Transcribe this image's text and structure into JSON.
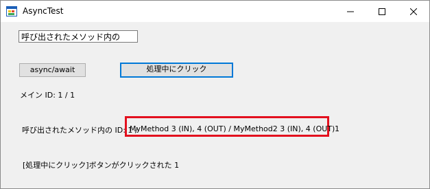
{
  "window": {
    "title": "AsyncTest",
    "controls": {
      "minimize": "minimize-icon",
      "maximize": "maximize-icon",
      "close": "close-icon"
    }
  },
  "form": {
    "textbox_value": "呼び出されたメソッド内の",
    "async_button_label": "async/await",
    "process_button_label": "処理中にクリック",
    "main_id_label": "メイン ID: 1 / 1",
    "called_method_prefix": "呼び出されたメソッド内の ID: 1 /",
    "called_method_highlight": "MyMethod 3 (IN), 4 (OUT) / MyMethod2 3 (IN), 4 (OUT)",
    "called_method_suffix": "1",
    "clicked_label": "[処理中にクリック]ボタンがクリックされた 1"
  },
  "colors": {
    "highlight_border": "#e3101e",
    "focus_border": "#0078d7"
  }
}
